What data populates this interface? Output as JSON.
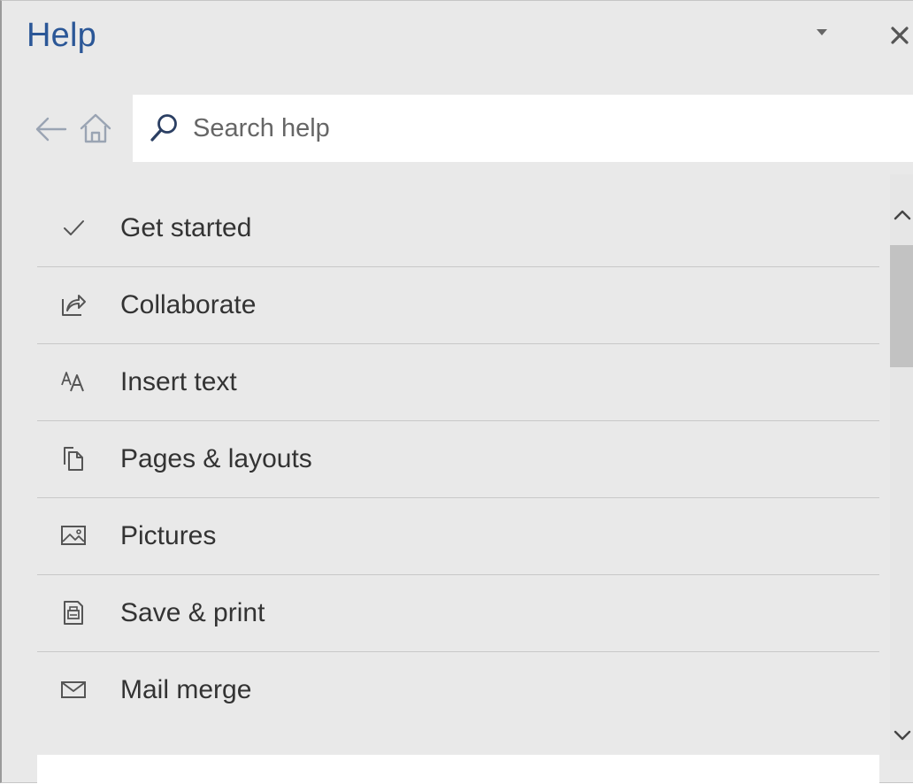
{
  "pane": {
    "title": "Help",
    "dropdown_icon": "caret-down-icon",
    "close_icon": "close-icon"
  },
  "nav": {
    "back_icon": "back-arrow-icon",
    "home_icon": "home-icon"
  },
  "search": {
    "placeholder": "Search help",
    "icon": "search-icon"
  },
  "topics": [
    {
      "label": "Get started",
      "icon": "checkmark-icon"
    },
    {
      "label": "Collaborate",
      "icon": "share-icon"
    },
    {
      "label": "Insert text",
      "icon": "font-size-icon"
    },
    {
      "label": "Pages & layouts",
      "icon": "pages-icon"
    },
    {
      "label": "Pictures",
      "icon": "picture-icon"
    },
    {
      "label": "Save & print",
      "icon": "save-print-icon"
    },
    {
      "label": "Mail merge",
      "icon": "envelope-icon"
    }
  ],
  "scroll": {
    "position_fraction": 0.0
  },
  "colors": {
    "title": "#2b5797",
    "pane_background": "#e9e9e9",
    "text": "#333333"
  }
}
